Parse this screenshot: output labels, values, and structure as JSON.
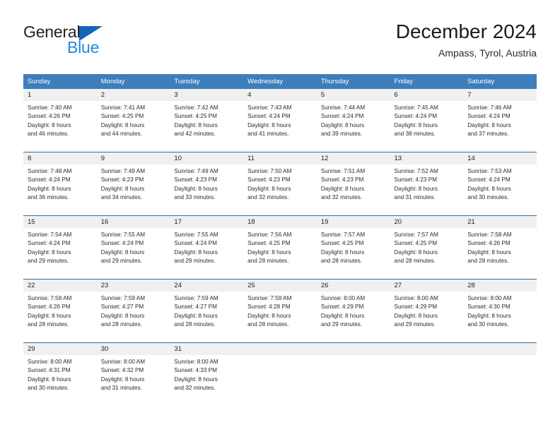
{
  "brand": {
    "word1": "General",
    "word2": "Blue",
    "triangle_color": "#1267B5",
    "word2_color": "#2288DD"
  },
  "header": {
    "title": "December 2024",
    "subtitle": "Ampass, Tyrol, Austria"
  },
  "theme": {
    "header_bg": "#3D7EBB",
    "row_divider": "#2E6DA8",
    "daynum_band_bg": "#F0F0F0",
    "cell_bg": "#FFFFFF"
  },
  "calendar": {
    "weekday_headers": [
      "Sunday",
      "Monday",
      "Tuesday",
      "Wednesday",
      "Thursday",
      "Friday",
      "Saturday"
    ],
    "weeks": [
      [
        {
          "day": "1",
          "sunrise": "Sunrise: 7:40 AM",
          "sunset": "Sunset: 4:26 PM",
          "daylight_1": "Daylight: 8 hours",
          "daylight_2": "and 46 minutes."
        },
        {
          "day": "2",
          "sunrise": "Sunrise: 7:41 AM",
          "sunset": "Sunset: 4:25 PM",
          "daylight_1": "Daylight: 8 hours",
          "daylight_2": "and 44 minutes."
        },
        {
          "day": "3",
          "sunrise": "Sunrise: 7:42 AM",
          "sunset": "Sunset: 4:25 PM",
          "daylight_1": "Daylight: 8 hours",
          "daylight_2": "and 42 minutes."
        },
        {
          "day": "4",
          "sunrise": "Sunrise: 7:43 AM",
          "sunset": "Sunset: 4:24 PM",
          "daylight_1": "Daylight: 8 hours",
          "daylight_2": "and 41 minutes."
        },
        {
          "day": "5",
          "sunrise": "Sunrise: 7:44 AM",
          "sunset": "Sunset: 4:24 PM",
          "daylight_1": "Daylight: 8 hours",
          "daylight_2": "and 39 minutes."
        },
        {
          "day": "6",
          "sunrise": "Sunrise: 7:45 AM",
          "sunset": "Sunset: 4:24 PM",
          "daylight_1": "Daylight: 8 hours",
          "daylight_2": "and 38 minutes."
        },
        {
          "day": "7",
          "sunrise": "Sunrise: 7:46 AM",
          "sunset": "Sunset: 4:24 PM",
          "daylight_1": "Daylight: 8 hours",
          "daylight_2": "and 37 minutes."
        }
      ],
      [
        {
          "day": "8",
          "sunrise": "Sunrise: 7:48 AM",
          "sunset": "Sunset: 4:24 PM",
          "daylight_1": "Daylight: 8 hours",
          "daylight_2": "and 36 minutes."
        },
        {
          "day": "9",
          "sunrise": "Sunrise: 7:49 AM",
          "sunset": "Sunset: 4:23 PM",
          "daylight_1": "Daylight: 8 hours",
          "daylight_2": "and 34 minutes."
        },
        {
          "day": "10",
          "sunrise": "Sunrise: 7:49 AM",
          "sunset": "Sunset: 4:23 PM",
          "daylight_1": "Daylight: 8 hours",
          "daylight_2": "and 33 minutes."
        },
        {
          "day": "11",
          "sunrise": "Sunrise: 7:50 AM",
          "sunset": "Sunset: 4:23 PM",
          "daylight_1": "Daylight: 8 hours",
          "daylight_2": "and 32 minutes."
        },
        {
          "day": "12",
          "sunrise": "Sunrise: 7:51 AM",
          "sunset": "Sunset: 4:23 PM",
          "daylight_1": "Daylight: 8 hours",
          "daylight_2": "and 32 minutes."
        },
        {
          "day": "13",
          "sunrise": "Sunrise: 7:52 AM",
          "sunset": "Sunset: 4:23 PM",
          "daylight_1": "Daylight: 8 hours",
          "daylight_2": "and 31 minutes."
        },
        {
          "day": "14",
          "sunrise": "Sunrise: 7:53 AM",
          "sunset": "Sunset: 4:24 PM",
          "daylight_1": "Daylight: 8 hours",
          "daylight_2": "and 30 minutes."
        }
      ],
      [
        {
          "day": "15",
          "sunrise": "Sunrise: 7:54 AM",
          "sunset": "Sunset: 4:24 PM",
          "daylight_1": "Daylight: 8 hours",
          "daylight_2": "and 29 minutes."
        },
        {
          "day": "16",
          "sunrise": "Sunrise: 7:55 AM",
          "sunset": "Sunset: 4:24 PM",
          "daylight_1": "Daylight: 8 hours",
          "daylight_2": "and 29 minutes."
        },
        {
          "day": "17",
          "sunrise": "Sunrise: 7:55 AM",
          "sunset": "Sunset: 4:24 PM",
          "daylight_1": "Daylight: 8 hours",
          "daylight_2": "and 29 minutes."
        },
        {
          "day": "18",
          "sunrise": "Sunrise: 7:56 AM",
          "sunset": "Sunset: 4:25 PM",
          "daylight_1": "Daylight: 8 hours",
          "daylight_2": "and 28 minutes."
        },
        {
          "day": "19",
          "sunrise": "Sunrise: 7:57 AM",
          "sunset": "Sunset: 4:25 PM",
          "daylight_1": "Daylight: 8 hours",
          "daylight_2": "and 28 minutes."
        },
        {
          "day": "20",
          "sunrise": "Sunrise: 7:57 AM",
          "sunset": "Sunset: 4:25 PM",
          "daylight_1": "Daylight: 8 hours",
          "daylight_2": "and 28 minutes."
        },
        {
          "day": "21",
          "sunrise": "Sunrise: 7:58 AM",
          "sunset": "Sunset: 4:26 PM",
          "daylight_1": "Daylight: 8 hours",
          "daylight_2": "and 28 minutes."
        }
      ],
      [
        {
          "day": "22",
          "sunrise": "Sunrise: 7:58 AM",
          "sunset": "Sunset: 4:26 PM",
          "daylight_1": "Daylight: 8 hours",
          "daylight_2": "and 28 minutes."
        },
        {
          "day": "23",
          "sunrise": "Sunrise: 7:59 AM",
          "sunset": "Sunset: 4:27 PM",
          "daylight_1": "Daylight: 8 hours",
          "daylight_2": "and 28 minutes."
        },
        {
          "day": "24",
          "sunrise": "Sunrise: 7:59 AM",
          "sunset": "Sunset: 4:27 PM",
          "daylight_1": "Daylight: 8 hours",
          "daylight_2": "and 28 minutes."
        },
        {
          "day": "25",
          "sunrise": "Sunrise: 7:59 AM",
          "sunset": "Sunset: 4:28 PM",
          "daylight_1": "Daylight: 8 hours",
          "daylight_2": "and 28 minutes."
        },
        {
          "day": "26",
          "sunrise": "Sunrise: 8:00 AM",
          "sunset": "Sunset: 4:29 PM",
          "daylight_1": "Daylight: 8 hours",
          "daylight_2": "and 29 minutes."
        },
        {
          "day": "27",
          "sunrise": "Sunrise: 8:00 AM",
          "sunset": "Sunset: 4:29 PM",
          "daylight_1": "Daylight: 8 hours",
          "daylight_2": "and 29 minutes."
        },
        {
          "day": "28",
          "sunrise": "Sunrise: 8:00 AM",
          "sunset": "Sunset: 4:30 PM",
          "daylight_1": "Daylight: 8 hours",
          "daylight_2": "and 30 minutes."
        }
      ],
      [
        {
          "day": "29",
          "sunrise": "Sunrise: 8:00 AM",
          "sunset": "Sunset: 4:31 PM",
          "daylight_1": "Daylight: 8 hours",
          "daylight_2": "and 30 minutes."
        },
        {
          "day": "30",
          "sunrise": "Sunrise: 8:00 AM",
          "sunset": "Sunset: 4:32 PM",
          "daylight_1": "Daylight: 8 hours",
          "daylight_2": "and 31 minutes."
        },
        {
          "day": "31",
          "sunrise": "Sunrise: 8:00 AM",
          "sunset": "Sunset: 4:33 PM",
          "daylight_1": "Daylight: 8 hours",
          "daylight_2": "and 32 minutes."
        },
        {
          "day": "",
          "sunrise": "",
          "sunset": "",
          "daylight_1": "",
          "daylight_2": ""
        },
        {
          "day": "",
          "sunrise": "",
          "sunset": "",
          "daylight_1": "",
          "daylight_2": ""
        },
        {
          "day": "",
          "sunrise": "",
          "sunset": "",
          "daylight_1": "",
          "daylight_2": ""
        },
        {
          "day": "",
          "sunrise": "",
          "sunset": "",
          "daylight_1": "",
          "daylight_2": ""
        }
      ]
    ]
  }
}
